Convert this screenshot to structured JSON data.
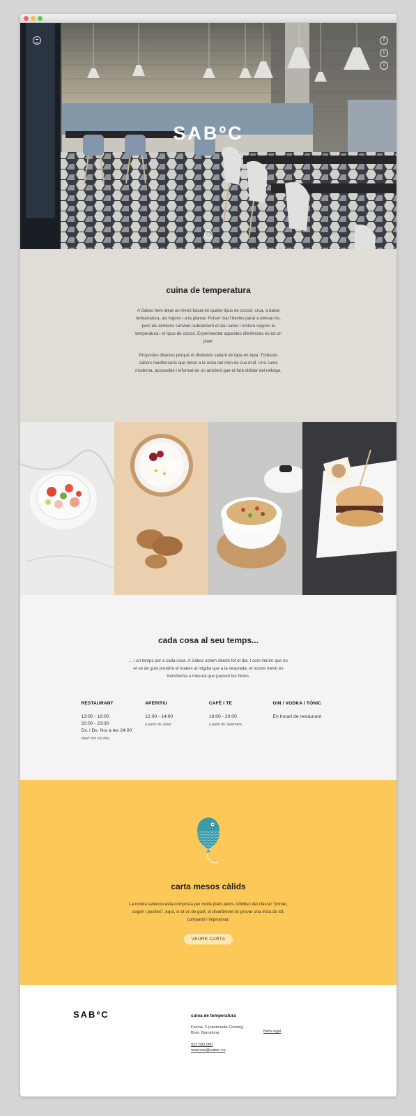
{
  "hero": {
    "logo": "SABºC",
    "social": [
      "f",
      "t",
      "i"
    ],
    "scroll_glyph": "⌄"
  },
  "intro": {
    "title": "cuina de temperatura",
    "p1": "A Saboc hem ideat un menú basat en quatre tipus de cocció: crua, a baixa temperatura, als fogons i a la planxa. Potser mai t’havies parat a pensar-ho, però els aliments canvien radicalment el seu sabor i textura segons la temperatura i el tipus de cocció. Experimentar aquestes diferències és tot un plaer.",
    "p2": "Propostes directes perquè et divideixis saltant de tapa en tapa. Trobaràs sabors mediterranis que miren a la resta del món de cua d’ull. Una cuina moderna, accessible i informal en un ambient que et farà oblidar del rellotge."
  },
  "hours": {
    "title": "cada cosa al seu temps...",
    "text": "... i un temps per a cada cosa. A Saboc estem oberts tot el dia. I com intuïm que no et ve de gust prendre el mateix al migdia que a la vesprada, el nostre menú es transforma a mesura que passen les hores.",
    "cols": [
      {
        "title": "RESTAURANT",
        "times": [
          "13:00 - 16:00",
          "20:00 - 23:30",
          "Dv. i Ds. fins a les 24:00"
        ],
        "note": "obert tots els dies"
      },
      {
        "title": "APERITIU",
        "times": [
          "12:00 - 14:00"
        ],
        "note": "a partir de Juliol"
      },
      {
        "title": "CAFÈ I TE",
        "times": [
          "16:00 - 20:00"
        ],
        "note": "a partir de Setembre"
      },
      {
        "title": "GIN / VODKA I TÒNIC",
        "times": [
          "En horari de restaurant"
        ],
        "note": ""
      }
    ]
  },
  "carta": {
    "title": "carta mesos càlids",
    "text": "La nostra selecció està composta per molts plats petits. Oblida’t del clàssic “primer, segon i postres”. Aquí, si et ve de gust, el divertiment és provar una mica de tot, compartir i improvisar.",
    "button": "VEURE CARTA"
  },
  "footer": {
    "logo": "SABºC",
    "title": "cuina de temperatura",
    "address_line1": "Fusina, 3 (cantonada Comerç)",
    "address_line2": "Born. Barcelona",
    "phone": "932 683 080",
    "email": "reserves@saboc.es",
    "legal": "Nota legal"
  },
  "colors": {
    "intro_bg": "#dfddd6",
    "hours_bg": "#f4f4f4",
    "carta_bg": "#fcc958",
    "fish": "#3a9aa8"
  }
}
